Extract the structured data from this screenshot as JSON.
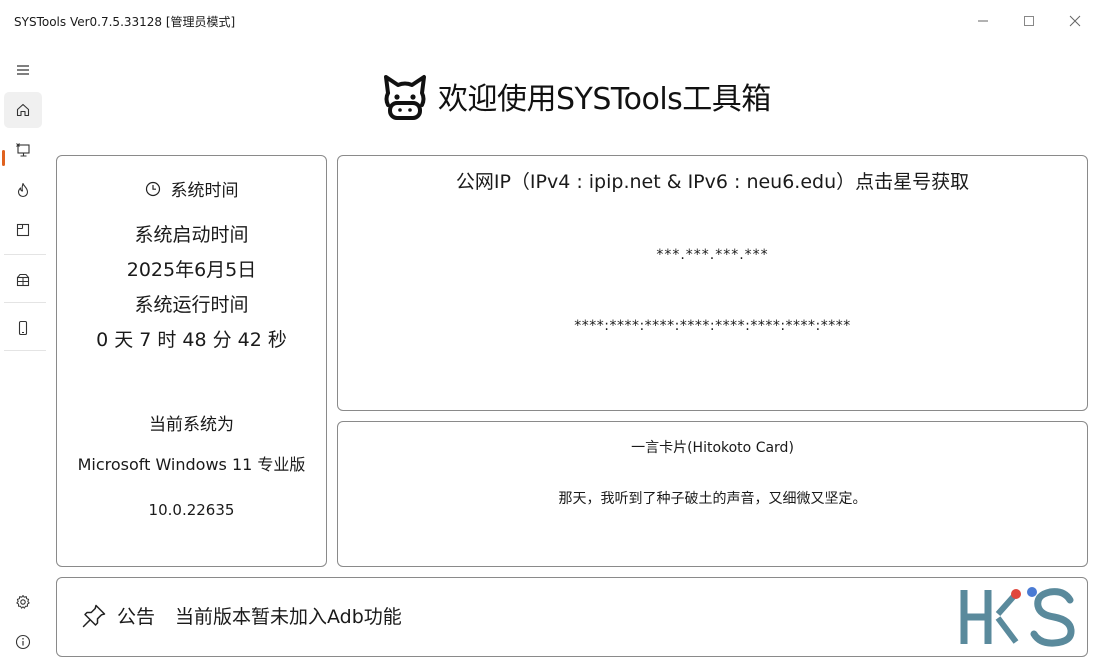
{
  "window": {
    "title": "SYSTools Ver0.7.5.33128 [管理员模式]"
  },
  "nav": {
    "items": [
      "menu-icon",
      "home-icon",
      "monitor-icon",
      "flame-icon",
      "note-icon",
      "box-icon",
      "phone-icon",
      "gear-icon",
      "info-icon"
    ],
    "accent": "#e0621f"
  },
  "header": {
    "title": "欢迎使用SYSTools工具箱"
  },
  "time_card": {
    "title": "系统时间",
    "boot_label": "系统启动时间",
    "boot_date": "2025年6月5日",
    "uptime_label": "系统运行时间",
    "uptime_value": "0 天 7 时 48 分 42 秒",
    "os_label": "当前系统为",
    "os_name": "Microsoft Windows 11 专业版",
    "os_version": "10.0.22635"
  },
  "ip_card": {
    "title": "公网IP（IPv4 : ipip.net & IPv6 : neu6.edu）点击星号获取",
    "ipv4": "***.***.***.***",
    "ipv6": "****:****:****:****:****:****:****:****"
  },
  "hitokoto": {
    "title": "一言卡片(Hitokoto Card)",
    "text": "那天，我听到了种子破土的声音，又细微又坚定。"
  },
  "notice": {
    "label": "公告",
    "text": "当前版本暂未加入Adb功能"
  },
  "watermark": {
    "text": "HKS",
    "colors": [
      "#5a8a9c",
      "#e0463c",
      "#4a7bd4"
    ]
  }
}
